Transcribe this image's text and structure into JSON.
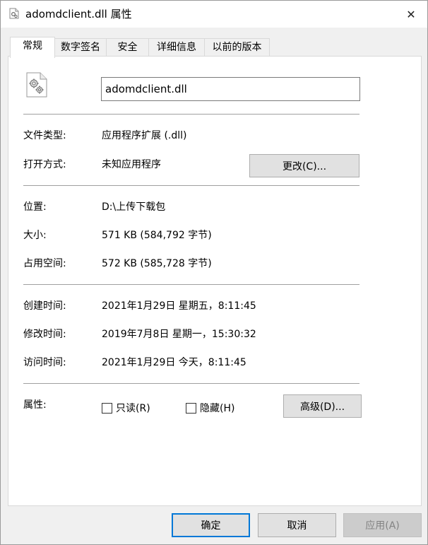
{
  "window": {
    "title": "adomdclient.dll 属性",
    "close_glyph": "✕"
  },
  "tabs": [
    {
      "label": "常规",
      "active": true
    },
    {
      "label": "数字签名",
      "active": false
    },
    {
      "label": "安全",
      "active": false
    },
    {
      "label": "详细信息",
      "active": false
    },
    {
      "label": "以前的版本",
      "active": false
    }
  ],
  "general": {
    "file_name": "adomdclient.dll",
    "file_type_label": "文件类型:",
    "file_type_value": "应用程序扩展 (.dll)",
    "open_with_label": "打开方式:",
    "open_with_value": "未知应用程序",
    "change_button": "更改(C)...",
    "location_label": "位置:",
    "location_value": "D:\\上传下载包",
    "size_label": "大小:",
    "size_value": "571 KB (584,792 字节)",
    "size_on_disk_label": "占用空间:",
    "size_on_disk_value": "572 KB (585,728 字节)",
    "created_label": "创建时间:",
    "created_value": "2021年1月29日 星期五，8:11:45",
    "modified_label": "修改时间:",
    "modified_value": "2019年7月8日 星期一，15:30:32",
    "accessed_label": "访问时间:",
    "accessed_value": "2021年1月29日 今天，8:11:45",
    "attributes_label": "属性:",
    "readonly_label": "只读(R)",
    "readonly_checked": false,
    "hidden_label": "隐藏(H)",
    "hidden_checked": false,
    "advanced_button": "高级(D)..."
  },
  "footer": {
    "ok": "确定",
    "cancel": "取消",
    "apply": "应用(A)",
    "apply_enabled": false
  },
  "icons": {
    "title_icon": "dll-file-icon",
    "file_icon": "gear-file-icon",
    "accent_color": "#0078d7"
  }
}
